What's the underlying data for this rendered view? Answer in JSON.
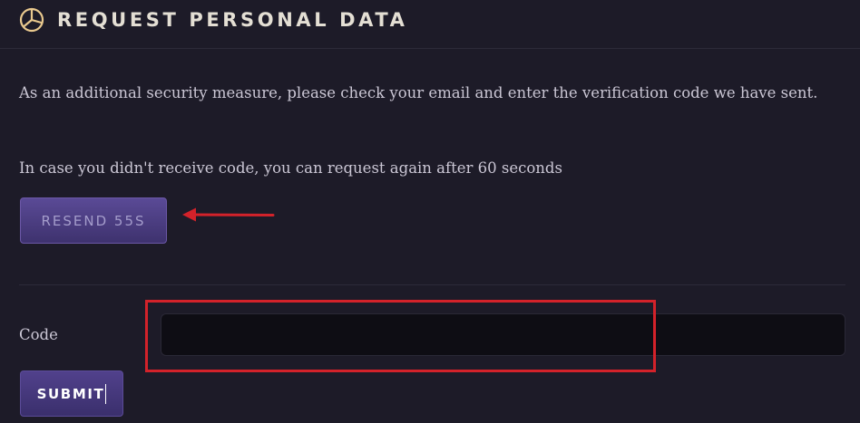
{
  "header": {
    "title": "REQUEST PERSONAL DATA",
    "icon": "pie-chart-icon"
  },
  "body": {
    "security_message": "As an additional security measure, please check your email and enter the verification code we have sent.",
    "resend_message": "In case you didn't receive code, you can request again after 60 seconds"
  },
  "resend": {
    "label": "RESEND 55S"
  },
  "code": {
    "label": "Code",
    "value": "",
    "placeholder": ""
  },
  "submit": {
    "label": "SUBMIT"
  },
  "annotations": {
    "arrow_color": "#d3222a",
    "highlight_color": "#d3222a"
  },
  "colors": {
    "background": "#1d1b28",
    "accent": "#4b3d86",
    "title": "#e4dfd4"
  }
}
